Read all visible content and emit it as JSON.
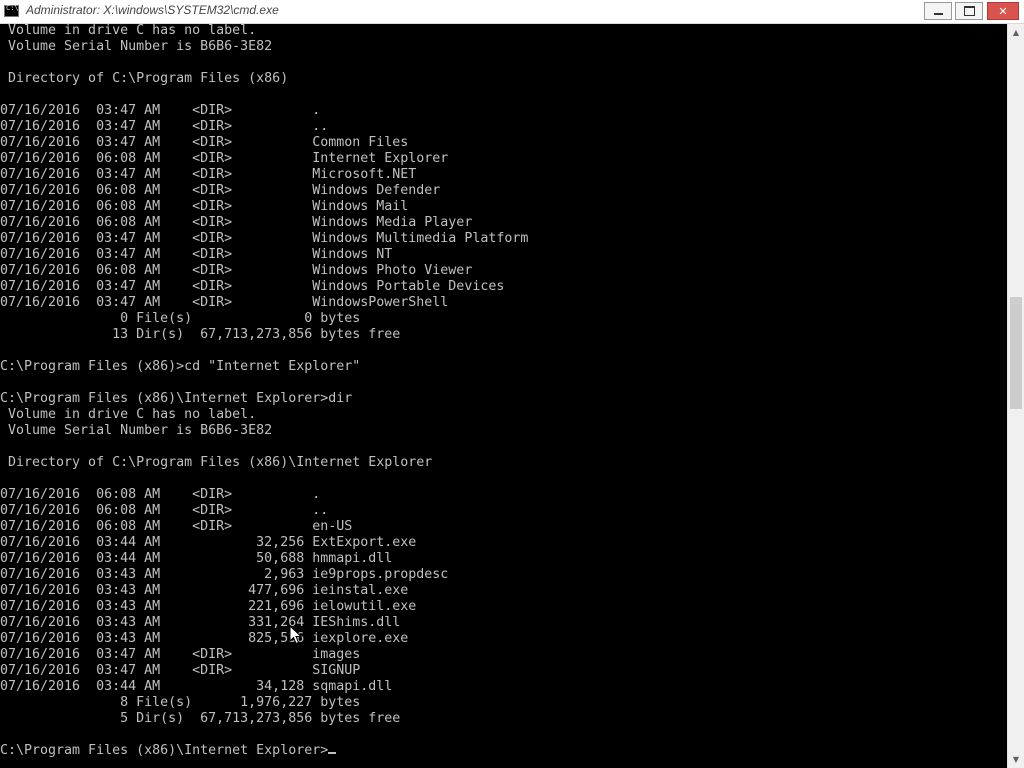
{
  "window": {
    "title": "Administrator: X:\\windows\\SYSTEM32\\cmd.exe",
    "icon": "cmd-icon",
    "controls": {
      "minimize_icon": "minimize-icon",
      "maximize_icon": "restore-icon",
      "close_label": "✕"
    }
  },
  "console": {
    "text_color": "#c0c0c0",
    "background": "#000000",
    "lines": [
      " Volume in drive C has no label.",
      " Volume Serial Number is B6B6-3E82",
      "",
      " Directory of C:\\Program Files (x86)",
      "",
      "07/16/2016  03:47 AM    <DIR>          .",
      "07/16/2016  03:47 AM    <DIR>          ..",
      "07/16/2016  03:47 AM    <DIR>          Common Files",
      "07/16/2016  06:08 AM    <DIR>          Internet Explorer",
      "07/16/2016  03:47 AM    <DIR>          Microsoft.NET",
      "07/16/2016  06:08 AM    <DIR>          Windows Defender",
      "07/16/2016  06:08 AM    <DIR>          Windows Mail",
      "07/16/2016  06:08 AM    <DIR>          Windows Media Player",
      "07/16/2016  03:47 AM    <DIR>          Windows Multimedia Platform",
      "07/16/2016  03:47 AM    <DIR>          Windows NT",
      "07/16/2016  06:08 AM    <DIR>          Windows Photo Viewer",
      "07/16/2016  03:47 AM    <DIR>          Windows Portable Devices",
      "07/16/2016  03:47 AM    <DIR>          WindowsPowerShell",
      "               0 File(s)              0 bytes",
      "              13 Dir(s)  67,713,273,856 bytes free",
      "",
      "C:\\Program Files (x86)>cd \"Internet Explorer\"",
      "",
      "C:\\Program Files (x86)\\Internet Explorer>dir",
      " Volume in drive C has no label.",
      " Volume Serial Number is B6B6-3E82",
      "",
      " Directory of C:\\Program Files (x86)\\Internet Explorer",
      "",
      "07/16/2016  06:08 AM    <DIR>          .",
      "07/16/2016  06:08 AM    <DIR>          ..",
      "07/16/2016  06:08 AM    <DIR>          en-US",
      "07/16/2016  03:44 AM            32,256 ExtExport.exe",
      "07/16/2016  03:44 AM            50,688 hmmapi.dll",
      "07/16/2016  03:43 AM             2,963 ie9props.propdesc",
      "07/16/2016  03:43 AM           477,696 ieinstal.exe",
      "07/16/2016  03:43 AM           221,696 ielowutil.exe",
      "07/16/2016  03:43 AM           331,264 IEShims.dll",
      "07/16/2016  03:43 AM           825,536 iexplore.exe",
      "07/16/2016  03:47 AM    <DIR>          images",
      "07/16/2016  03:47 AM    <DIR>          SIGNUP",
      "07/16/2016  03:44 AM            34,128 sqmapi.dll",
      "               8 File(s)      1,976,227 bytes",
      "               5 Dir(s)  67,713,273,856 bytes free",
      "",
      "C:\\Program Files (x86)\\Internet Explorer>"
    ]
  },
  "scrollbar": {
    "up_icon": "scroll-up-arrow-icon",
    "down_icon": "scroll-down-arrow-icon",
    "position_fraction": 0.38
  },
  "pointer": {
    "icon": "mouse-pointer-icon"
  }
}
